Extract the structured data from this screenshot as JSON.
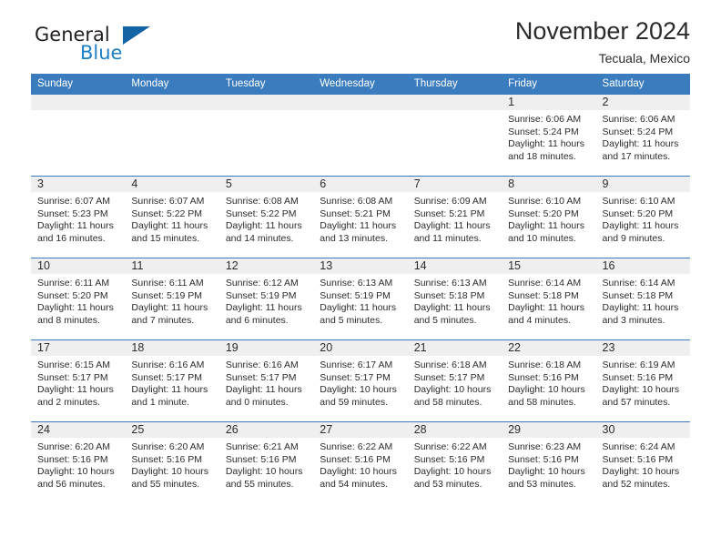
{
  "brand": {
    "name_part1": "General",
    "name_part2": "Blue",
    "triangle_color": "#1464a5",
    "blue_color": "#1e7fc4"
  },
  "header": {
    "title": "November 2024",
    "subtitle": "Tecuala, Mexico"
  },
  "colors": {
    "header_blue": "#3a7cbe",
    "daynum_band": "#efefef",
    "text": "#2b2b2b"
  },
  "weekday_headers": [
    "Sunday",
    "Monday",
    "Tuesday",
    "Wednesday",
    "Thursday",
    "Friday",
    "Saturday"
  ],
  "weeks": [
    [
      {
        "day": "",
        "blank": true
      },
      {
        "day": "",
        "blank": true
      },
      {
        "day": "",
        "blank": true
      },
      {
        "day": "",
        "blank": true
      },
      {
        "day": "",
        "blank": true
      },
      {
        "day": "1",
        "sunrise": "Sunrise: 6:06 AM",
        "sunset": "Sunset: 5:24 PM",
        "daylight": "Daylight: 11 hours and 18 minutes."
      },
      {
        "day": "2",
        "sunrise": "Sunrise: 6:06 AM",
        "sunset": "Sunset: 5:24 PM",
        "daylight": "Daylight: 11 hours and 17 minutes."
      }
    ],
    [
      {
        "day": "3",
        "sunrise": "Sunrise: 6:07 AM",
        "sunset": "Sunset: 5:23 PM",
        "daylight": "Daylight: 11 hours and 16 minutes."
      },
      {
        "day": "4",
        "sunrise": "Sunrise: 6:07 AM",
        "sunset": "Sunset: 5:22 PM",
        "daylight": "Daylight: 11 hours and 15 minutes."
      },
      {
        "day": "5",
        "sunrise": "Sunrise: 6:08 AM",
        "sunset": "Sunset: 5:22 PM",
        "daylight": "Daylight: 11 hours and 14 minutes."
      },
      {
        "day": "6",
        "sunrise": "Sunrise: 6:08 AM",
        "sunset": "Sunset: 5:21 PM",
        "daylight": "Daylight: 11 hours and 13 minutes."
      },
      {
        "day": "7",
        "sunrise": "Sunrise: 6:09 AM",
        "sunset": "Sunset: 5:21 PM",
        "daylight": "Daylight: 11 hours and 11 minutes."
      },
      {
        "day": "8",
        "sunrise": "Sunrise: 6:10 AM",
        "sunset": "Sunset: 5:20 PM",
        "daylight": "Daylight: 11 hours and 10 minutes."
      },
      {
        "day": "9",
        "sunrise": "Sunrise: 6:10 AM",
        "sunset": "Sunset: 5:20 PM",
        "daylight": "Daylight: 11 hours and 9 minutes."
      }
    ],
    [
      {
        "day": "10",
        "sunrise": "Sunrise: 6:11 AM",
        "sunset": "Sunset: 5:20 PM",
        "daylight": "Daylight: 11 hours and 8 minutes."
      },
      {
        "day": "11",
        "sunrise": "Sunrise: 6:11 AM",
        "sunset": "Sunset: 5:19 PM",
        "daylight": "Daylight: 11 hours and 7 minutes."
      },
      {
        "day": "12",
        "sunrise": "Sunrise: 6:12 AM",
        "sunset": "Sunset: 5:19 PM",
        "daylight": "Daylight: 11 hours and 6 minutes."
      },
      {
        "day": "13",
        "sunrise": "Sunrise: 6:13 AM",
        "sunset": "Sunset: 5:19 PM",
        "daylight": "Daylight: 11 hours and 5 minutes."
      },
      {
        "day": "14",
        "sunrise": "Sunrise: 6:13 AM",
        "sunset": "Sunset: 5:18 PM",
        "daylight": "Daylight: 11 hours and 5 minutes."
      },
      {
        "day": "15",
        "sunrise": "Sunrise: 6:14 AM",
        "sunset": "Sunset: 5:18 PM",
        "daylight": "Daylight: 11 hours and 4 minutes."
      },
      {
        "day": "16",
        "sunrise": "Sunrise: 6:14 AM",
        "sunset": "Sunset: 5:18 PM",
        "daylight": "Daylight: 11 hours and 3 minutes."
      }
    ],
    [
      {
        "day": "17",
        "sunrise": "Sunrise: 6:15 AM",
        "sunset": "Sunset: 5:17 PM",
        "daylight": "Daylight: 11 hours and 2 minutes."
      },
      {
        "day": "18",
        "sunrise": "Sunrise: 6:16 AM",
        "sunset": "Sunset: 5:17 PM",
        "daylight": "Daylight: 11 hours and 1 minute."
      },
      {
        "day": "19",
        "sunrise": "Sunrise: 6:16 AM",
        "sunset": "Sunset: 5:17 PM",
        "daylight": "Daylight: 11 hours and 0 minutes."
      },
      {
        "day": "20",
        "sunrise": "Sunrise: 6:17 AM",
        "sunset": "Sunset: 5:17 PM",
        "daylight": "Daylight: 10 hours and 59 minutes."
      },
      {
        "day": "21",
        "sunrise": "Sunrise: 6:18 AM",
        "sunset": "Sunset: 5:17 PM",
        "daylight": "Daylight: 10 hours and 58 minutes."
      },
      {
        "day": "22",
        "sunrise": "Sunrise: 6:18 AM",
        "sunset": "Sunset: 5:16 PM",
        "daylight": "Daylight: 10 hours and 58 minutes."
      },
      {
        "day": "23",
        "sunrise": "Sunrise: 6:19 AM",
        "sunset": "Sunset: 5:16 PM",
        "daylight": "Daylight: 10 hours and 57 minutes."
      }
    ],
    [
      {
        "day": "24",
        "sunrise": "Sunrise: 6:20 AM",
        "sunset": "Sunset: 5:16 PM",
        "daylight": "Daylight: 10 hours and 56 minutes."
      },
      {
        "day": "25",
        "sunrise": "Sunrise: 6:20 AM",
        "sunset": "Sunset: 5:16 PM",
        "daylight": "Daylight: 10 hours and 55 minutes."
      },
      {
        "day": "26",
        "sunrise": "Sunrise: 6:21 AM",
        "sunset": "Sunset: 5:16 PM",
        "daylight": "Daylight: 10 hours and 55 minutes."
      },
      {
        "day": "27",
        "sunrise": "Sunrise: 6:22 AM",
        "sunset": "Sunset: 5:16 PM",
        "daylight": "Daylight: 10 hours and 54 minutes."
      },
      {
        "day": "28",
        "sunrise": "Sunrise: 6:22 AM",
        "sunset": "Sunset: 5:16 PM",
        "daylight": "Daylight: 10 hours and 53 minutes."
      },
      {
        "day": "29",
        "sunrise": "Sunrise: 6:23 AM",
        "sunset": "Sunset: 5:16 PM",
        "daylight": "Daylight: 10 hours and 53 minutes."
      },
      {
        "day": "30",
        "sunrise": "Sunrise: 6:24 AM",
        "sunset": "Sunset: 5:16 PM",
        "daylight": "Daylight: 10 hours and 52 minutes."
      }
    ]
  ]
}
